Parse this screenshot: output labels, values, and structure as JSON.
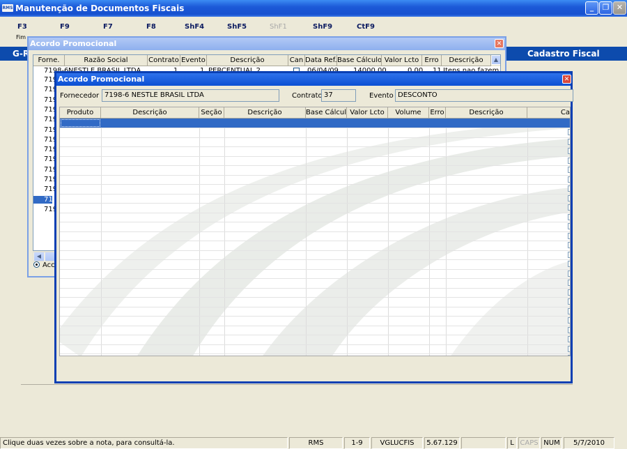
{
  "main_window": {
    "title": "Manutenção de Documentos Fiscais",
    "icon_label": "RMS",
    "controls": {
      "minimize": "_",
      "maximize": "❐",
      "close": "✕"
    }
  },
  "function_keys": [
    {
      "key": "F3",
      "sub": "Fim",
      "disabled": false
    },
    {
      "key": "F9",
      "sub": "",
      "disabled": false
    },
    {
      "key": "F7",
      "sub": "",
      "disabled": false
    },
    {
      "key": "F8",
      "sub": "",
      "disabled": false
    },
    {
      "key": "ShF4",
      "sub": "",
      "disabled": false
    },
    {
      "key": "ShF5",
      "sub": "",
      "disabled": false
    },
    {
      "key": "ShF1",
      "sub": "",
      "disabled": true
    },
    {
      "key": "ShF9",
      "sub": "",
      "disabled": false
    },
    {
      "key": "CtF9",
      "sub": "",
      "disabled": false
    }
  ],
  "banner": {
    "left": "G-R",
    "right": "Cadastro Fiscal"
  },
  "dialog1": {
    "title": "Acordo Promocional",
    "close": "✕",
    "columns": [
      "Forne.",
      "Razão Social",
      "Contrato",
      "Evento",
      "Descrição",
      "Can",
      "Data Ref.",
      "Base Cálculo",
      "Valor Lcto",
      "Erro",
      "Descrição"
    ],
    "first_row": {
      "forne": "7198-6",
      "razao_social": "NESTLE BRASIL LTDA",
      "contrato": "1",
      "evento": "1",
      "descricao": "PERCENTUAL 2",
      "data_ref": "06/04/09",
      "base_calculo": "14000,00",
      "valor_lcto": "0,00",
      "erro": "11",
      "descricao2": "Itens nao fazem"
    },
    "stub_rows": [
      "719",
      "719",
      "719",
      "719",
      "719",
      "719",
      "719",
      "719",
      "719",
      "719",
      "719",
      "719",
      "719",
      "719"
    ],
    "selected_stub_index": 12,
    "radio_label": "Acc",
    "scroll_up": "▲",
    "scroll_left": "◀"
  },
  "dialog2": {
    "title": "Acordo Promocional",
    "close": "✕",
    "fornecedor_label": "Fornecedor",
    "fornecedor_value": "7198-6 NESTLE BRASIL LTDA",
    "contrato_label": "Contrato:",
    "contrato_value": "37",
    "evento_label": "Evento",
    "evento_value": "DESCONTO",
    "columns": [
      "Produto",
      "Descrição",
      "Seção",
      "Descrição",
      "Base Cálculo",
      "Valor Lcto",
      "Volume",
      "Erro",
      "Descrição",
      "Ca"
    ]
  },
  "status_bar": {
    "message": "Clique duas vezes sobre a nota, para consultá-la.",
    "app": "RMS",
    "range": "1-9",
    "user": "VGLUCFIS",
    "version": "5.67.129",
    "l": "L",
    "caps": "CAPS",
    "num": "NUM",
    "date": "5/7/2010"
  }
}
